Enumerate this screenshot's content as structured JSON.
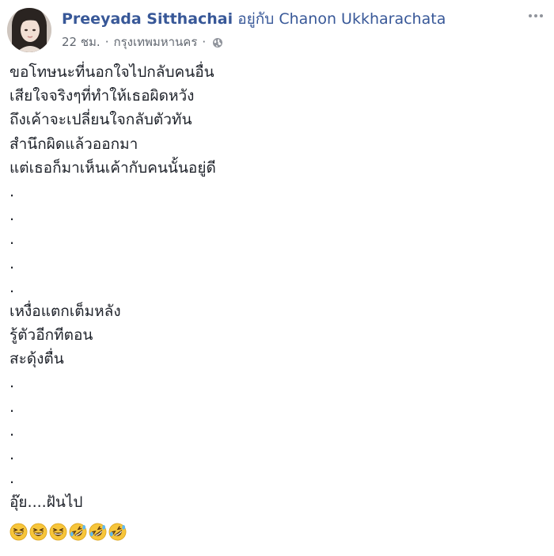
{
  "post": {
    "author_name": "Preeyada Sitthachai",
    "with_text": "อยู่กับ",
    "tagged_name": "Chanon Ukkharachata",
    "timestamp": "22 ชม.",
    "location": "กรุงเทพมหานคร",
    "separator": "·",
    "privacy_icon": "globe-icon",
    "options_icon": "more-options-icon",
    "lines": [
      "ขอโทษนะที่นอกใจไปกลับคนอื่น",
      "เสียใจจริงๆที่ทำให้เธอผิดหวัง",
      "ถึงเค้าจะเปลี่ยนใจกลับตัวทัน",
      "สำนึกผิดแล้วออกมา",
      "แต่เธอก็มาเห็นเค้ากับคนนั้นอยู่ดี",
      ".",
      ".",
      ".",
      ".",
      ".",
      "เหงื่อแตกเต็มหลัง",
      "รู้ตัวอีกทีตอน",
      "สะดุ้งตื่น",
      ".",
      ".",
      ".",
      ".",
      ".",
      "อุ๊ย....ฝันไป"
    ],
    "emojis": [
      "grinning-squinting-face",
      "grinning-squinting-face",
      "grinning-squinting-face",
      "rolling-on-floor-laughing",
      "rolling-on-floor-laughing",
      "rolling-on-floor-laughing"
    ]
  },
  "colors": {
    "link": "#385898",
    "text": "#1d2129",
    "meta": "#616770",
    "emoji_yellow": "#f7c53a"
  }
}
